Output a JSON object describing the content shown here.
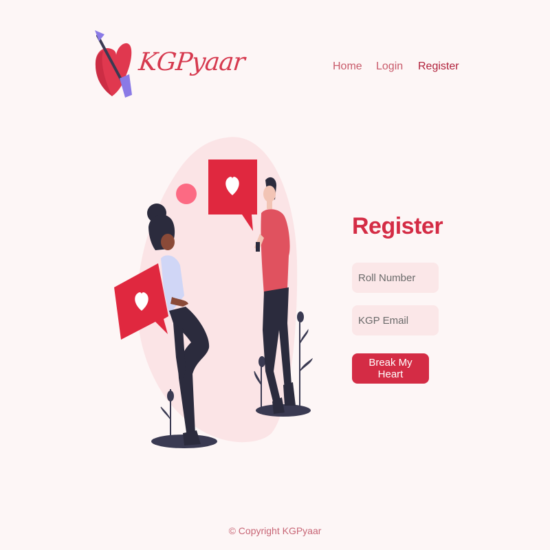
{
  "brand": {
    "name": "KGPyaar"
  },
  "nav": {
    "home": "Home",
    "login": "Login",
    "register": "Register"
  },
  "form": {
    "title": "Register",
    "roll_placeholder": "Roll Number",
    "email_placeholder": "KGP Email",
    "submit_label": "Break My Heart"
  },
  "footer": {
    "copyright": "© Copyright KGPyaar"
  },
  "colors": {
    "accent": "#d42c45",
    "background": "#fdf6f6",
    "field_bg": "#fbe7e8"
  },
  "icons": [
    "heart-arrow-logo-icon",
    "heart-icon"
  ]
}
